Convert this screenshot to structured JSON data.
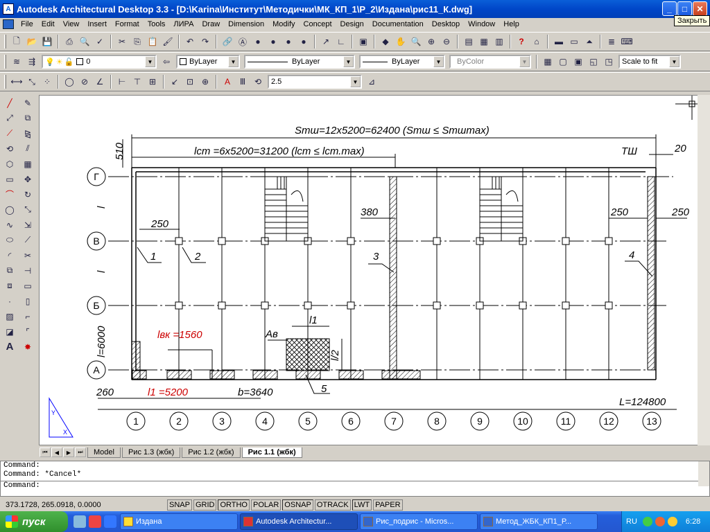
{
  "window": {
    "title": "Autodesk Architectural Desktop 3.3 - [D:\\Karina\\Институт\\Методички\\МК_КП_1\\Р_2\\Издана\\рис11_К.dwg]",
    "tooltip": "Закрыть",
    "btn_min": "_",
    "btn_max": "□",
    "btn_close": "✕"
  },
  "menu": [
    "File",
    "Edit",
    "View",
    "Insert",
    "Format",
    "Tools",
    "ЛИРА",
    "Draw",
    "Dimension",
    "Modify",
    "Concept",
    "Design",
    "Documentation",
    "Desktop",
    "Window",
    "Help"
  ],
  "layer_toolbar": {
    "layer_value": "0",
    "color": "ByLayer",
    "linetype": "ByLayer",
    "lineweight": "ByLayer",
    "plotstyle": "ByColor",
    "scale": "Scale to fit"
  },
  "dim_toolbar": {
    "dim_value": "2.5"
  },
  "drawing": {
    "s_tsh": "Sтш=12x5200=62400  (Sтш ≤ Sтшmax)",
    "l_ct": "lст =6x5200=31200  (lст ≤ lст.max)",
    "dim_510": "510",
    "dim_20": "20",
    "label_tsh": "ТШ",
    "dim_250_left": "250",
    "dim_380": "380",
    "dim_250_r1": "250",
    "dim_250_r2": "250",
    "label_1": "1",
    "label_2": "2",
    "label_3": "3",
    "label_4": "4",
    "label_5": "5",
    "lvk": "lвк =1560",
    "l1": "l1",
    "ab": "Aв",
    "l2": "l/2",
    "dim_l6000": "l=6000",
    "dim_260": "260",
    "l1_5200": "l1 =5200",
    "b_3640": "b=3640",
    "L_total": "L=124800",
    "rows": [
      "Г",
      "В",
      "Б",
      "А"
    ],
    "cols": [
      "1",
      "2",
      "3",
      "4",
      "5",
      "6",
      "7",
      "8",
      "9",
      "10",
      "11",
      "12",
      "13"
    ],
    "side_l1": "l",
    "side_l2": "l",
    "y_axis": "Y",
    "x_axis": "X"
  },
  "tabs": [
    "Model",
    "Рис 1.3 (жбк)",
    "Рис 1.2 (жбк)",
    "Рис 1.1 (жбк)"
  ],
  "command": [
    "Command:",
    "Command: *Cancel*",
    "Command:"
  ],
  "status": {
    "coords": "373.1728, 265.0918, 0.0000",
    "buttons": [
      "SNAP",
      "GRID",
      "ORTHO",
      "POLAR",
      "OSNAP",
      "OTRACK",
      "LWT",
      "PAPER"
    ]
  },
  "taskbar": {
    "start": "пуск",
    "tasks": [
      "Издана",
      "Autodesk Architectur...",
      "Рис_подрис - Micros...",
      "Метод_ЖБК_КП1_Р..."
    ],
    "lang": "RU",
    "clock": "6:28"
  },
  "colors": {
    "accent": "#0046c8",
    "drawing_bg": "#ffffff",
    "red_text": "#cc0000"
  }
}
